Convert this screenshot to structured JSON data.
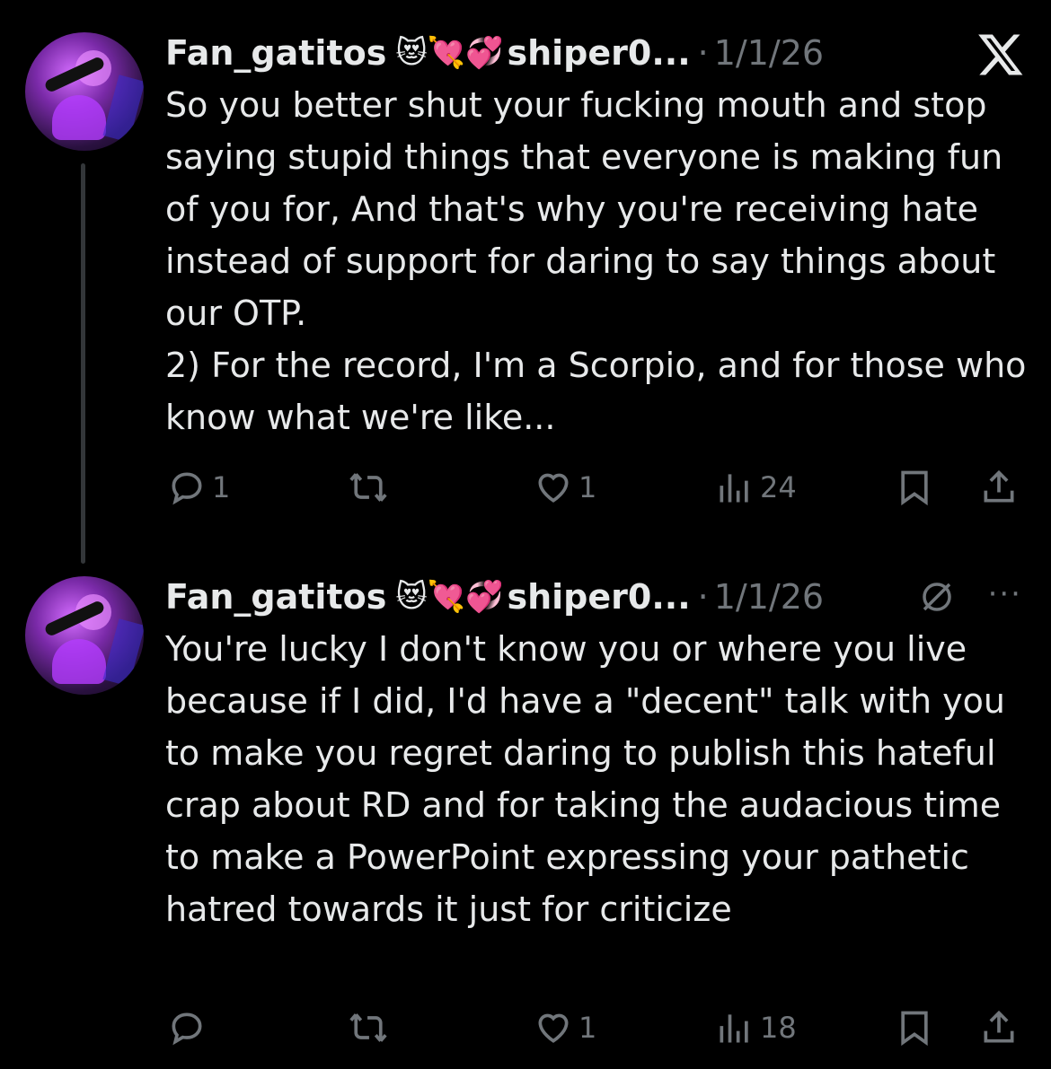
{
  "tweets": [
    {
      "name": "Fan_gatitos",
      "emojis": "😻💘💞",
      "handle": "shiper0...",
      "separator": "·",
      "date": "1/1/26",
      "text": "So you better shut your fucking mouth and stop saying stupid things that everyone is making fun of you for, And that's why you're receiving hate instead of support for daring to say things about our OTP.\n2) For the record, I'm a Scorpio, and for those who know what we're like...",
      "replies": "1",
      "retweets": "",
      "likes": "1",
      "views": "24",
      "top_icon": "x-logo-icon"
    },
    {
      "name": "Fan_gatitos",
      "emojis": "😻💘💞",
      "handle": "shiper0...",
      "separator": "·",
      "date": "1/1/26",
      "text": "You're lucky I don't know you or where you live because if I did, I'd have a \"decent\" talk with you to make you regret daring to publish this hateful crap about RD and for taking the audacious time to make a PowerPoint expressing your pathetic hatred towards it just for criticize",
      "replies": "",
      "retweets": "",
      "likes": "1",
      "views": "18",
      "top_icon": "muted-icon",
      "more": "···"
    }
  ],
  "colors": {
    "background": "#000000",
    "text": "#e7e9ea",
    "muted": "#71767b",
    "thread_line": "#333639"
  }
}
